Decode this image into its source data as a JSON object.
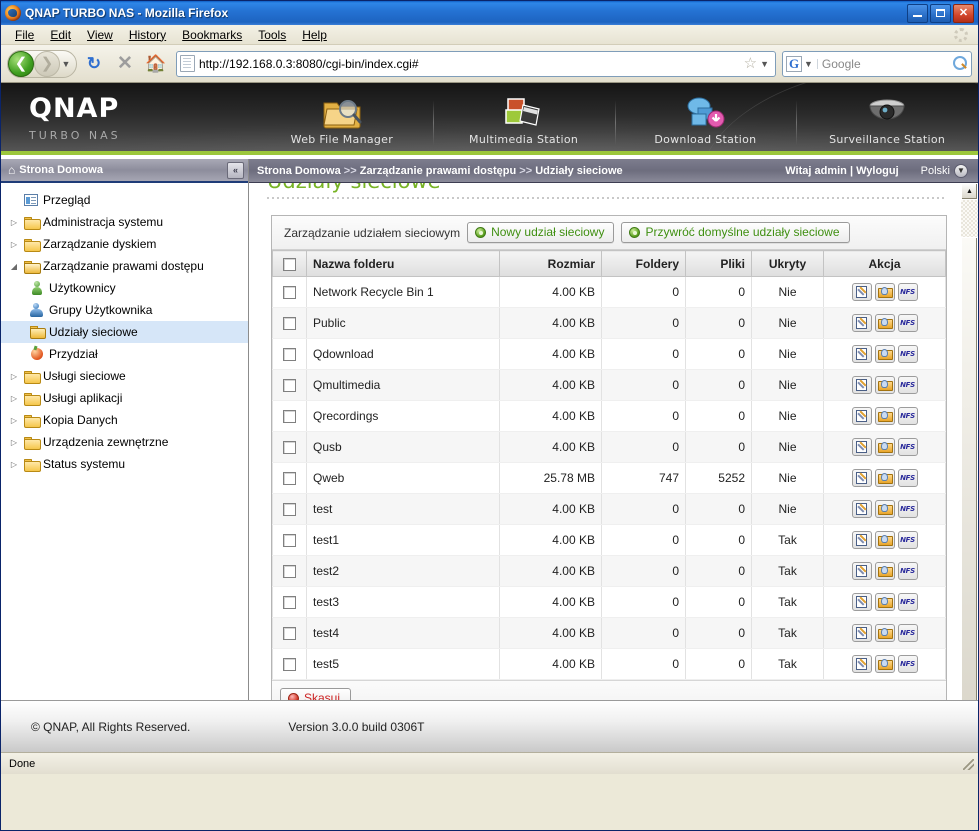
{
  "browser": {
    "window_title": "QNAP TURBO NAS - Mozilla Firefox",
    "menus": [
      "File",
      "Edit",
      "View",
      "History",
      "Bookmarks",
      "Tools",
      "Help"
    ],
    "url": "http://192.168.0.3:8080/cgi-bin/index.cgi#",
    "search_placeholder": "Google",
    "search_engine": "G",
    "status": "Done",
    "window_buttons": {
      "minimize": "_",
      "maximize": "□",
      "close": "×"
    }
  },
  "header": {
    "logo": "QNAP",
    "tagline": "TURBO NAS",
    "apps": [
      {
        "label": "Web File Manager",
        "icon": "folder-search-icon"
      },
      {
        "label": "Multimedia Station",
        "icon": "photo-film-icon"
      },
      {
        "label": "Download Station",
        "icon": "download-cloud-icon"
      },
      {
        "label": "Surveillance Station",
        "icon": "camera-dome-icon"
      }
    ]
  },
  "crumbbar": {
    "crumbs": [
      "Strona Domowa",
      "Zarządzanie prawami dostępu",
      "Udziały sieciowe"
    ],
    "separator": ">>",
    "welcome": "Witaj admin | Wyloguj",
    "language": "Polski"
  },
  "sidebar": {
    "title": "Strona Domowa",
    "collapse_label": "«",
    "items": [
      {
        "label": "Przegląd",
        "icon": "overview-icon",
        "twisty": "",
        "level": 1,
        "selected": false
      },
      {
        "label": "Administracja systemu",
        "icon": "folder-closed-icon",
        "twisty": "▷",
        "level": 1,
        "selected": false
      },
      {
        "label": "Zarządzanie dyskiem",
        "icon": "folder-closed-icon",
        "twisty": "▷",
        "level": 1,
        "selected": false
      },
      {
        "label": "Zarządzanie prawami dostępu",
        "icon": "folder-open-icon",
        "twisty": "◢",
        "level": 1,
        "selected": false
      },
      {
        "label": "Użytkownicy",
        "icon": "user-icon",
        "twisty": "",
        "level": 2,
        "selected": false
      },
      {
        "label": "Grupy Użytkownika",
        "icon": "users-icon",
        "twisty": "",
        "level": 2,
        "selected": false
      },
      {
        "label": "Udziały sieciowe",
        "icon": "shared-folder-icon",
        "twisty": "",
        "level": 2,
        "selected": true
      },
      {
        "label": "Przydział",
        "icon": "quota-icon",
        "twisty": "",
        "level": 2,
        "selected": false
      },
      {
        "label": "Usługi sieciowe",
        "icon": "folder-closed-icon",
        "twisty": "▷",
        "level": 1,
        "selected": false
      },
      {
        "label": "Usługi aplikacji",
        "icon": "folder-closed-icon",
        "twisty": "▷",
        "level": 1,
        "selected": false
      },
      {
        "label": "Kopia Danych",
        "icon": "folder-closed-icon",
        "twisty": "▷",
        "level": 1,
        "selected": false
      },
      {
        "label": "Urządzenia zewnętrzne",
        "icon": "folder-closed-icon",
        "twisty": "▷",
        "level": 1,
        "selected": false
      },
      {
        "label": "Status systemu",
        "icon": "folder-closed-icon",
        "twisty": "▷",
        "level": 1,
        "selected": false
      }
    ]
  },
  "main": {
    "page_title": "Udziały sieciowe",
    "panel_title": "Zarządzanie udziałem sieciowym",
    "new_share_button": "Nowy udział sieciowy",
    "restore_defaults_button": "Przywróć domyślne udziały sieciowe",
    "delete_button": "Skasuj",
    "columns": [
      "",
      "Nazwa folderu",
      "Rozmiar",
      "Foldery",
      "Pliki",
      "Ukryty",
      "Akcja"
    ],
    "action_icons": [
      "edit-icon",
      "permissions-icon",
      "nfs-icon"
    ],
    "nfs_label": "NFS",
    "rows": [
      {
        "name": "Network Recycle Bin 1",
        "size": "4.00 KB",
        "folders": "0",
        "files": "0",
        "hidden": "Nie"
      },
      {
        "name": "Public",
        "size": "4.00 KB",
        "folders": "0",
        "files": "0",
        "hidden": "Nie"
      },
      {
        "name": "Qdownload",
        "size": "4.00 KB",
        "folders": "0",
        "files": "0",
        "hidden": "Nie"
      },
      {
        "name": "Qmultimedia",
        "size": "4.00 KB",
        "folders": "0",
        "files": "0",
        "hidden": "Nie"
      },
      {
        "name": "Qrecordings",
        "size": "4.00 KB",
        "folders": "0",
        "files": "0",
        "hidden": "Nie"
      },
      {
        "name": "Qusb",
        "size": "4.00 KB",
        "folders": "0",
        "files": "0",
        "hidden": "Nie"
      },
      {
        "name": "Qweb",
        "size": "25.78 MB",
        "folders": "747",
        "files": "5252",
        "hidden": "Nie"
      },
      {
        "name": "test",
        "size": "4.00 KB",
        "folders": "0",
        "files": "0",
        "hidden": "Nie"
      },
      {
        "name": "test1",
        "size": "4.00 KB",
        "folders": "0",
        "files": "0",
        "hidden": "Tak"
      },
      {
        "name": "test2",
        "size": "4.00 KB",
        "folders": "0",
        "files": "0",
        "hidden": "Tak"
      },
      {
        "name": "test3",
        "size": "4.00 KB",
        "folders": "0",
        "files": "0",
        "hidden": "Tak"
      },
      {
        "name": "test4",
        "size": "4.00 KB",
        "folders": "0",
        "files": "0",
        "hidden": "Tak"
      },
      {
        "name": "test5",
        "size": "4.00 KB",
        "folders": "0",
        "files": "0",
        "hidden": "Tak"
      }
    ]
  },
  "footer": {
    "copyright": "© QNAP, All Rights Reserved.",
    "version": "Version 3.0.0 build 0306T"
  },
  "colors": {
    "accent_green": "#9cc73c",
    "title_green": "#77b324",
    "button_green": "#3f8f11",
    "delete_red": "#cc2222",
    "selection_blue": "#d6e6f8",
    "titlebar_blue": "#2573d4"
  }
}
